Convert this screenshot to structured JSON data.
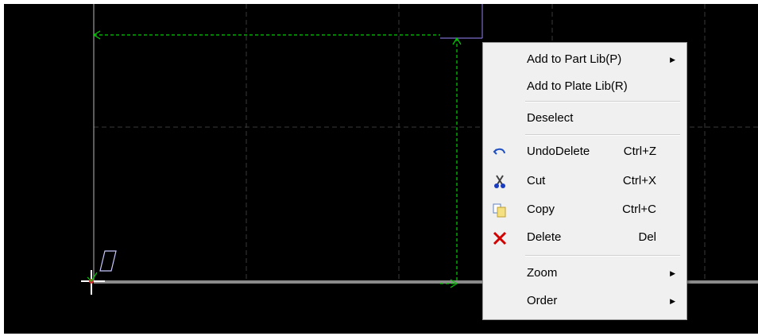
{
  "context_menu": {
    "items": [
      {
        "label": "Add to Part Lib(P)",
        "shortcut": "",
        "submenu": true,
        "icon": ""
      },
      {
        "label": "Add to Plate Lib(R)",
        "shortcut": "",
        "submenu": false,
        "icon": ""
      },
      {
        "label": "Deselect",
        "shortcut": "",
        "submenu": false,
        "icon": ""
      },
      {
        "label": "UndoDelete",
        "shortcut": "Ctrl+Z",
        "submenu": false,
        "icon": "undo-icon"
      },
      {
        "label": "Cut",
        "shortcut": "Ctrl+X",
        "submenu": false,
        "icon": "scissors-icon"
      },
      {
        "label": "Copy",
        "shortcut": "Ctrl+C",
        "submenu": false,
        "icon": "copy-icon"
      },
      {
        "label": "Delete",
        "shortcut": "Del",
        "submenu": false,
        "icon": "delete-x-icon"
      },
      {
        "label": "Zoom",
        "shortcut": "",
        "submenu": true,
        "icon": ""
      },
      {
        "label": "Order",
        "shortcut": "",
        "submenu": true,
        "icon": ""
      }
    ]
  },
  "colors": {
    "canvas_background": "#000000",
    "grid_line": "#3a3a3a",
    "dimension_line": "#00d000",
    "axis_line": "#9a9a9a",
    "selection_outline": "#7a6cc8",
    "delete_icon": "#d00000",
    "undo_icon": "#2050c0"
  }
}
